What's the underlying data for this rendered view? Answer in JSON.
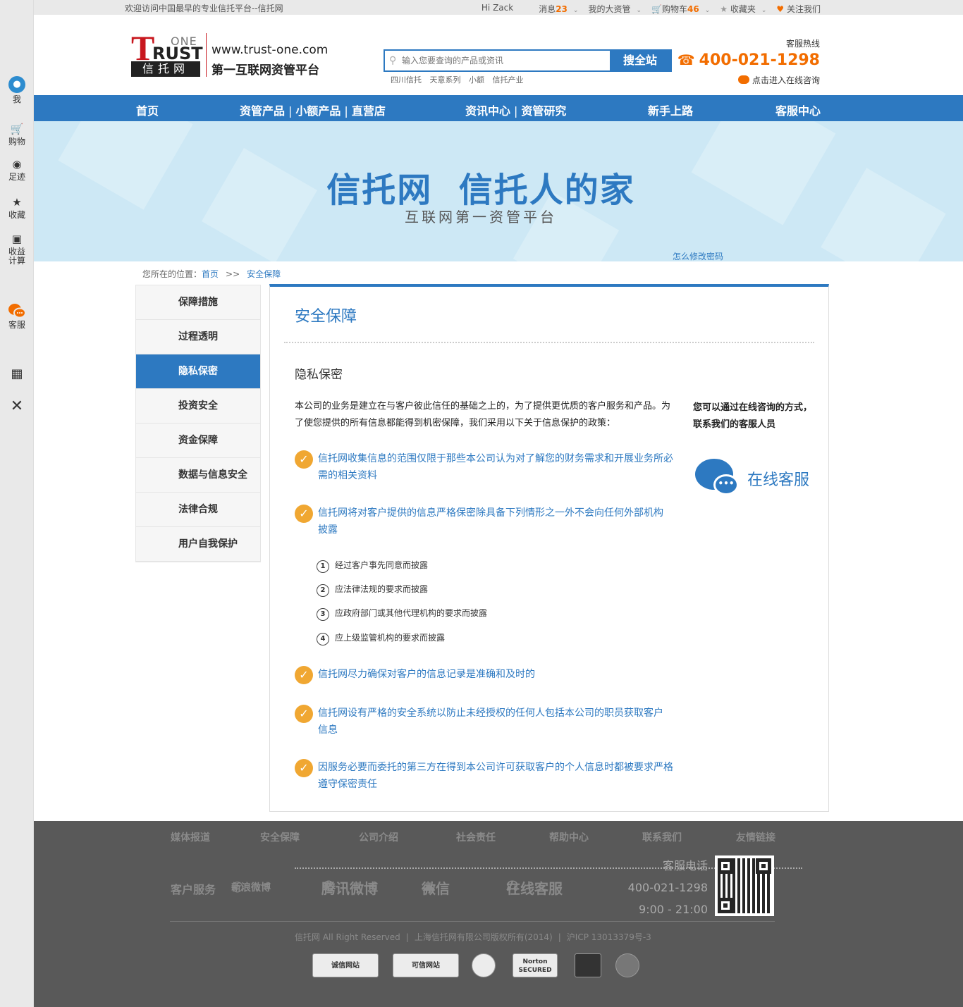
{
  "left_bar": {
    "items": [
      {
        "label": "我",
        "icon": "user-icon"
      },
      {
        "label": "购物",
        "icon": "cart-icon"
      },
      {
        "label": "足迹",
        "icon": "eye-icon"
      },
      {
        "label": "收藏",
        "icon": "star-icon"
      },
      {
        "label": "收益计算",
        "icon": "calculator-icon"
      },
      {
        "label": "客服",
        "icon": "chat-icon"
      },
      {
        "label": "",
        "icon": "qrcode-icon"
      },
      {
        "label": "",
        "icon": "close-icon"
      }
    ]
  },
  "topbar": {
    "welcome": "欢迎访问中国最早的专业信托平台--信托网",
    "greeting": "Hi   Zack",
    "messages_label": "消息",
    "messages_count": "23",
    "my_assets": "我的大资管",
    "cart_label": "购物车",
    "cart_count": "46",
    "favorites": "收藏夹",
    "follow": "关注我们"
  },
  "header": {
    "logo": {
      "t": "T",
      "one": "ONE",
      "rust": "RUST",
      "cn": "信托网"
    },
    "url": "www.trust-one.com",
    "slogan": "第一互联网资管平台",
    "search_placeholder": "输入您要查询的产品或资讯",
    "search_button": "搜全站",
    "hot_words": [
      "四川信托",
      "天意系列",
      "小额",
      "信托产业"
    ],
    "hotline_label": "客服热线",
    "hotline_phone": "400-021-1298",
    "online_consult": "点击进入在线咨询"
  },
  "nav": {
    "home": "首页",
    "assets": "资管产品",
    "small": "小额产品",
    "direct": "直营店",
    "news": "资讯中心",
    "research": "资管研究",
    "newbie": "新手上路",
    "service": "客服中心"
  },
  "banner": {
    "title": "信托网  信托人的家",
    "subtitle": "互联网第一资管平台",
    "password_link": "怎么修改密码"
  },
  "breadcrumb": {
    "prefix": "您所在的位置：",
    "home": "首页",
    "arrow": ">>",
    "current": "安全保障"
  },
  "side_menu": [
    "保障措施",
    "过程透明",
    "隐私保密",
    "投资安全",
    "资金保障",
    "数据与信息安全",
    "法律合规",
    "用户自我保护"
  ],
  "content": {
    "title": "安全保障",
    "subtitle": "隐私保密",
    "intro": "本公司的业务是建立在与客户彼此信任的基础之上的，为了提供更优质的客户服务和产品。为了使您提供的所有信息都能得到机密保障，我们采用以下关于信息保护的政策：",
    "checks": [
      "信托网收集信息的范围仅限于那些本公司认为对了解您的财务需求和开展业务所必需的相关资料",
      "信托网将对客户提供的信息严格保密除具备下列情形之一外不会向任何外部机构披露",
      "信托网尽力确保对客户的信息记录是准确和及时的",
      "信托网设有严格的安全系统以防止未经授权的任何人包括本公司的职员获取客户信息",
      "因服务必要而委托的第三方在得到本公司许可获取客户的个人信息时都被要求严格遵守保密责任"
    ],
    "numbered": [
      "经过客户事先同意而披露",
      "应法律法规的要求而披露",
      "应政府部门或其他代理机构的要求而披露",
      "应上级监管机构的要求而披露"
    ],
    "side_note": "您可以通过在线咨询的方式，联系我们的客服人员",
    "online_service": "在线客服"
  },
  "footer": {
    "links": [
      "媒体报道",
      "安全保障",
      "公司介绍",
      "社会责任",
      "帮助中心",
      "联系我们",
      "友情链接"
    ],
    "customer_service": "客户服务",
    "social": [
      "新浪微博",
      "腾讯微博",
      "微信",
      "在线客服"
    ],
    "contact_label": "客服电话",
    "contact_phone": "400-021-1298",
    "contact_hours": "9:00 - 21:00",
    "copyright": "信托网 All Right Reserved",
    "company": "上海信托网有限公司版权所有(2014)",
    "icp": "沪ICP 13013379号-3",
    "badges": [
      "诚信网站",
      "可信网站",
      "Norton SECURED"
    ]
  },
  "colors": {
    "brand_blue": "#2d79c1",
    "accent_orange": "#f26d00",
    "check_orange": "#f0a732",
    "logo_red": "#c8171e",
    "footer_bg": "#595959"
  }
}
